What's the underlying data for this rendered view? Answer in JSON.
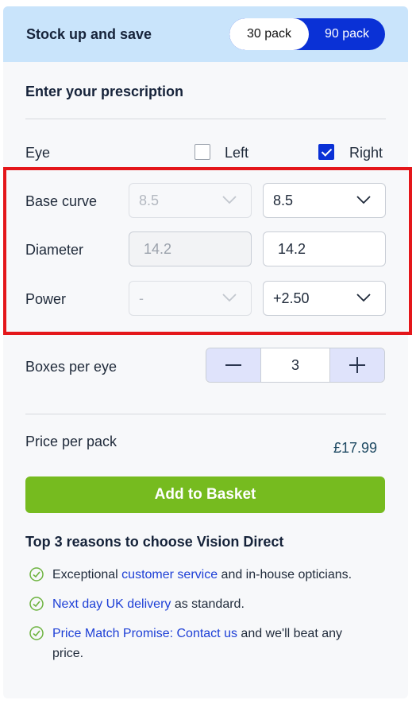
{
  "promo": {
    "title": "Stock up and save",
    "pack_options": [
      "30 pack",
      "90 pack"
    ],
    "selected_pack": "30 pack"
  },
  "prescription": {
    "heading": "Enter your prescription",
    "eye_label": "Eye",
    "left_label": "Left",
    "right_label": "Right",
    "left_checked": false,
    "right_checked": true,
    "base_curve": {
      "label": "Base curve",
      "left": "8.5",
      "right": "8.5"
    },
    "diameter": {
      "label": "Diameter",
      "left": "14.2",
      "right": "14.2"
    },
    "power": {
      "label": "Power",
      "left": "-",
      "right": "+2.50"
    }
  },
  "boxes": {
    "label": "Boxes per eye",
    "value": "3",
    "minus": "−",
    "plus": "+"
  },
  "price": {
    "label": "Price per pack",
    "value": "£17.99"
  },
  "add_button": "Add to Basket",
  "reasons": {
    "title": "Top 3 reasons to choose Vision Direct",
    "r1": {
      "a": "Exceptional ",
      "link": "customer service",
      "b": " and in-house opticians."
    },
    "r2": {
      "link": "Next day UK delivery",
      "b": " as standard."
    },
    "r3": {
      "link1": "Price Match Promise",
      "sep": ": ",
      "link2": "Contact us",
      "b": " and we'll beat any price."
    }
  },
  "colors": {
    "accent": "#0a31d6",
    "cta": "#76bb1f",
    "highlight": "#e4161a",
    "promo_bg": "#c9e4fb"
  }
}
